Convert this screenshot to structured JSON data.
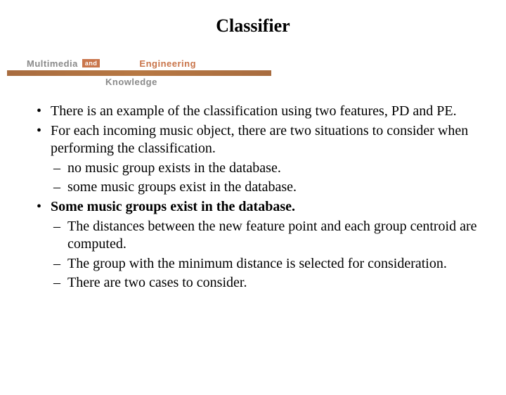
{
  "title": "Classifier",
  "logo": {
    "multimedia": "Multimedia",
    "and": "and",
    "engineering": "Engineering",
    "knowledge": "Knowledge"
  },
  "bullets": [
    {
      "text": "There is an example of the classification using two features, PD and PE.",
      "bold": false
    },
    {
      "text": "For each incoming music object, there are two situations to consider when performing the classification.",
      "bold": false,
      "sub": [
        "no music group exists in the database.",
        "some music groups exist in the database."
      ]
    },
    {
      "text": "Some music groups exist in the database.",
      "bold": true,
      "sub": [
        "The distances between the new feature point and each group centroid are computed.",
        "The group with the minimum distance is selected for consideration.",
        "There are two cases to consider."
      ]
    }
  ]
}
